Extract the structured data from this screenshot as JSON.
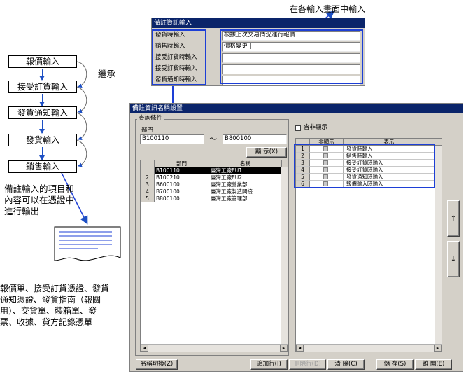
{
  "annotations": {
    "top_note": "在各輸入畫面中輸入",
    "inherit": "繼承",
    "remark_note": [
      "備註輸入的項目和",
      "內容可以在憑證中",
      "進行輸出"
    ],
    "documents_note": [
      "報價單、接受訂貨憑證、發貨",
      "通知憑證、發貨指南（報關",
      "用）、交貨單、裝箱單、發",
      "票、收據、貸方記錄憑單"
    ]
  },
  "flow": {
    "steps": [
      "報價輸入",
      "接受訂貨輸入",
      "發貨通知輸入",
      "發貨輸入",
      "銷售輸入"
    ]
  },
  "remark_window": {
    "title": "備註資訊輸入",
    "labels": [
      "發貨時輸入",
      "銷售時輸入",
      "接受訂貨時輸入",
      "接受訂貨時輸入",
      "發貨通知時輸入"
    ],
    "values": [
      "根據上次交易情況進行報價",
      "價格變更 |",
      "",
      "",
      ""
    ]
  },
  "settings_window": {
    "title": "備註資訊名稱設置",
    "group_label": "查詢條件",
    "dept_label": "部門",
    "dept_from": "B100110",
    "range_sep": "～",
    "dept_to": "B800100",
    "show_button": "顯 示(X)",
    "dept_table": {
      "headers": [
        "部門",
        "名稱"
      ],
      "rows": [
        {
          "num": "",
          "dept": "B100110",
          "name": "臺灣工廠EU1"
        },
        {
          "num": "2",
          "dept": "B100210",
          "name": "臺灣工廠EU2"
        },
        {
          "num": "3",
          "dept": "B600100",
          "name": "臺灣工廠營業部"
        },
        {
          "num": "4",
          "dept": "B700100",
          "name": "臺灣工廠製造間接"
        },
        {
          "num": "5",
          "dept": "B800100",
          "name": "臺灣工廠管理部"
        }
      ]
    },
    "include_hidden_label": "含非顯示",
    "display_table": {
      "headers": [
        "非顯示",
        "表示"
      ],
      "rows": [
        {
          "num": "1",
          "label": "發貨時輸入"
        },
        {
          "num": "2",
          "label": "銷售時輸入"
        },
        {
          "num": "3",
          "label": "接受訂貨時輸入"
        },
        {
          "num": "4",
          "label": "接受訂貨時輸入"
        },
        {
          "num": "5",
          "label": "發貨通知時輸入"
        },
        {
          "num": "6",
          "label": "報價輸入時輸入"
        }
      ]
    },
    "up_arrow": "↑",
    "down_arrow": "↓",
    "buttons": {
      "rename": "名稱切換(Z)",
      "add_row": "追加行(I)",
      "delete_row": "刪除行(D)",
      "clear": "清 除(C)",
      "save": "儲 存(S)",
      "close": "離 開(E)"
    }
  },
  "colors": {
    "highlight": "#1d3fd6",
    "title_bar": "#0a246a",
    "window_bg": "#d4d0c8"
  }
}
